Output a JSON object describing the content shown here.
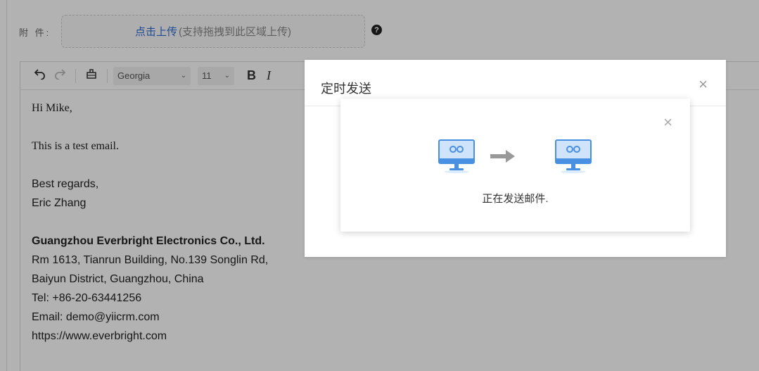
{
  "attachment": {
    "label": "附 件:",
    "upload_link": "点击上传",
    "upload_hint": "(支持拖拽到此区域上传)"
  },
  "toolbar": {
    "undo_icon": "undo-icon",
    "redo_icon": "redo-icon",
    "clear_format_icon": "clear-format-icon",
    "font_family": "Georgia",
    "font_size": "11",
    "bold": "B",
    "italic": "I"
  },
  "email_body": {
    "greeting": "Hi Mike,",
    "message": "This is a test email.",
    "regards": "Best regards,",
    "sender": "Eric Zhang",
    "company": "Guangzhou Everbright Electronics Co., Ltd.",
    "address1": "Rm 1613, Tianrun Building, No.139 Songlin Rd,",
    "address2": "Baiyun District, Guangzhou, China",
    "tel": "Tel: +86-20-63441256",
    "email": "Email: demo@yiicrm.com",
    "website": "https://www.everbright.com"
  },
  "schedule_dialog": {
    "title": "定时发送",
    "close": "×"
  },
  "sending_popup": {
    "close": "×",
    "status": "正在发送邮件."
  },
  "colors": {
    "link": "#2f6bd3",
    "monitor_blue": "#4a90e2",
    "monitor_fill": "#cfe3fb"
  }
}
